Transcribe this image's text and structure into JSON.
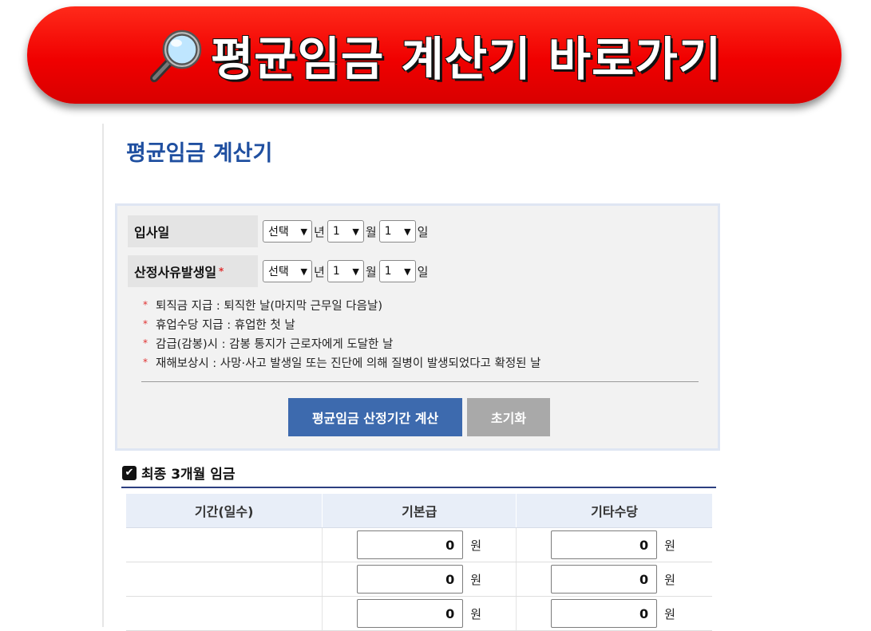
{
  "banner": {
    "text": "평균임금 계산기 바로가기",
    "icon": "magnifier-icon"
  },
  "page": {
    "title": "평균임금 계산기"
  },
  "form": {
    "hire_date": {
      "label": "입사일",
      "year": "선택",
      "year_unit": "년",
      "month": "1",
      "month_unit": "월",
      "day": "1",
      "day_unit": "일"
    },
    "event_date": {
      "label": "산정사유발생일",
      "required_mark": "*",
      "year": "선택",
      "year_unit": "년",
      "month": "1",
      "month_unit": "월",
      "day": "1",
      "day_unit": "일"
    },
    "notes": [
      "퇴직금 지급 : 퇴직한 날(마지막 근무일 다음날)",
      "휴업수당 지급 : 휴업한 첫 날",
      "감급(감봉)시 : 감봉 통지가 근로자에게 도달한 날",
      "재해보상시 : 사망·사고 발생일 또는 진단에 의해 질병이 발생되었다고 확정된 날"
    ],
    "note_mark": "*",
    "calc_button": "평균임금 산정기간 계산",
    "reset_button": "초기화"
  },
  "section": {
    "checkbox_checked": true,
    "title": "최종 3개월 임금",
    "columns": [
      "기간(일수)",
      "기본급",
      "기타수당"
    ],
    "rows": [
      {
        "period": "",
        "base_pay": "0",
        "other_allowance": "0"
      },
      {
        "period": "",
        "base_pay": "0",
        "other_allowance": "0"
      },
      {
        "period": "",
        "base_pay": "0",
        "other_allowance": "0"
      }
    ],
    "currency_unit": "원"
  },
  "colors": {
    "banner": "#f00000",
    "title": "#1f4fa0",
    "calc_button": "#3d6aae",
    "reset_button": "#a9a9a9",
    "required": "#e03030"
  }
}
